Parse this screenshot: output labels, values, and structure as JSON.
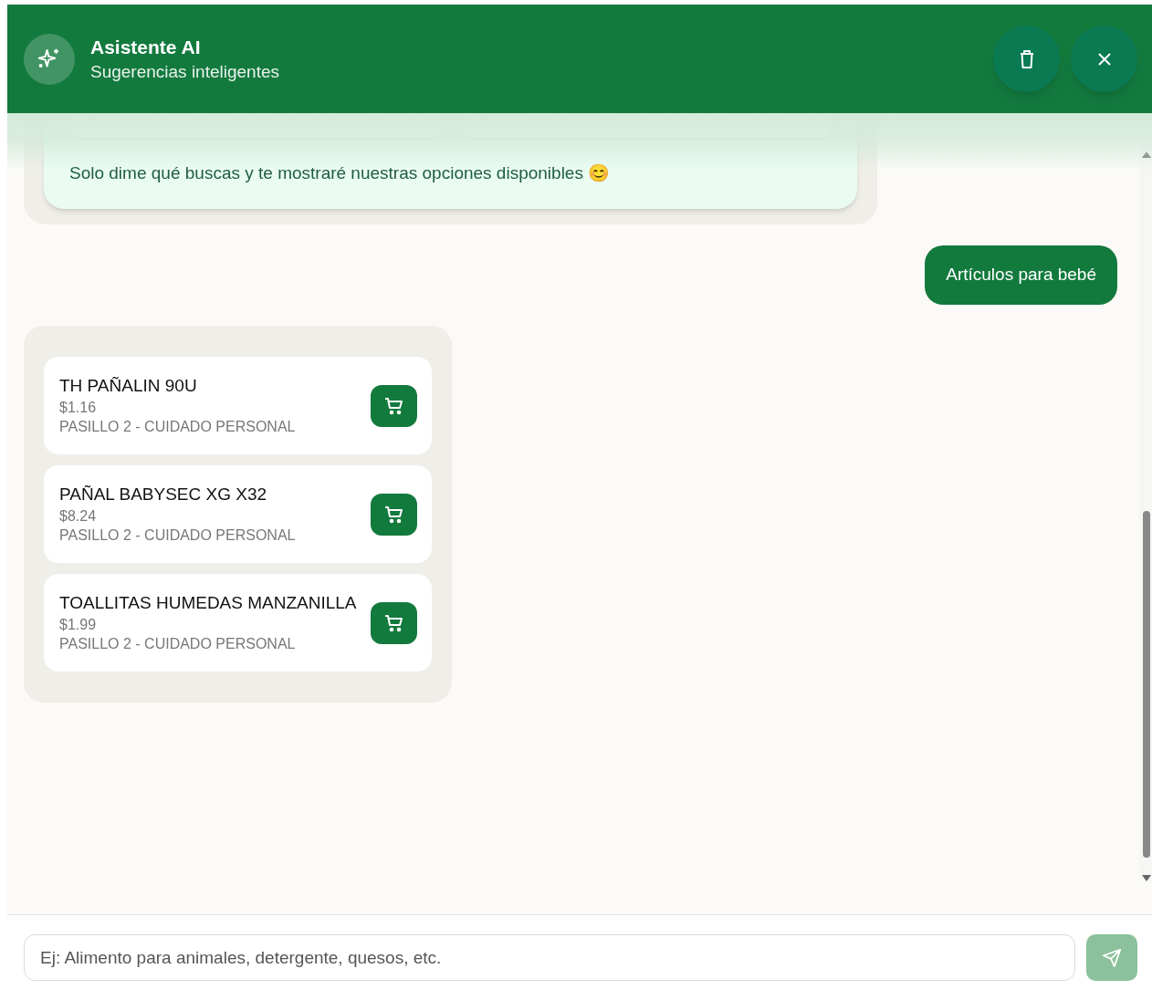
{
  "header": {
    "title": "Asistente AI",
    "subtitle": "Sugerencias inteligentes"
  },
  "messages": [
    {
      "kind": "bot_text",
      "text": "Solo dime qué buscas y te mostraré nuestras opciones disponibles 😊"
    },
    {
      "kind": "user",
      "text": "Artículos para bebé"
    },
    {
      "kind": "products",
      "products": [
        {
          "name": "TH PAÑALIN 90U",
          "price": "$1.16",
          "location": "PASILLO 2 - CUIDADO PERSONAL"
        },
        {
          "name": "PAÑAL BABYSEC XG X32",
          "price": "$8.24",
          "location": "PASILLO 2 - CUIDADO PERSONAL"
        },
        {
          "name": "TOALLITAS HUMEDAS MANZANILLA",
          "price": "$1.99",
          "location": "PASILLO 2 - CUIDADO PERSONAL"
        }
      ]
    }
  ],
  "composer": {
    "placeholder": "Ej: Alimento para animales, detergente, quesos, etc.",
    "send_disabled": true
  }
}
